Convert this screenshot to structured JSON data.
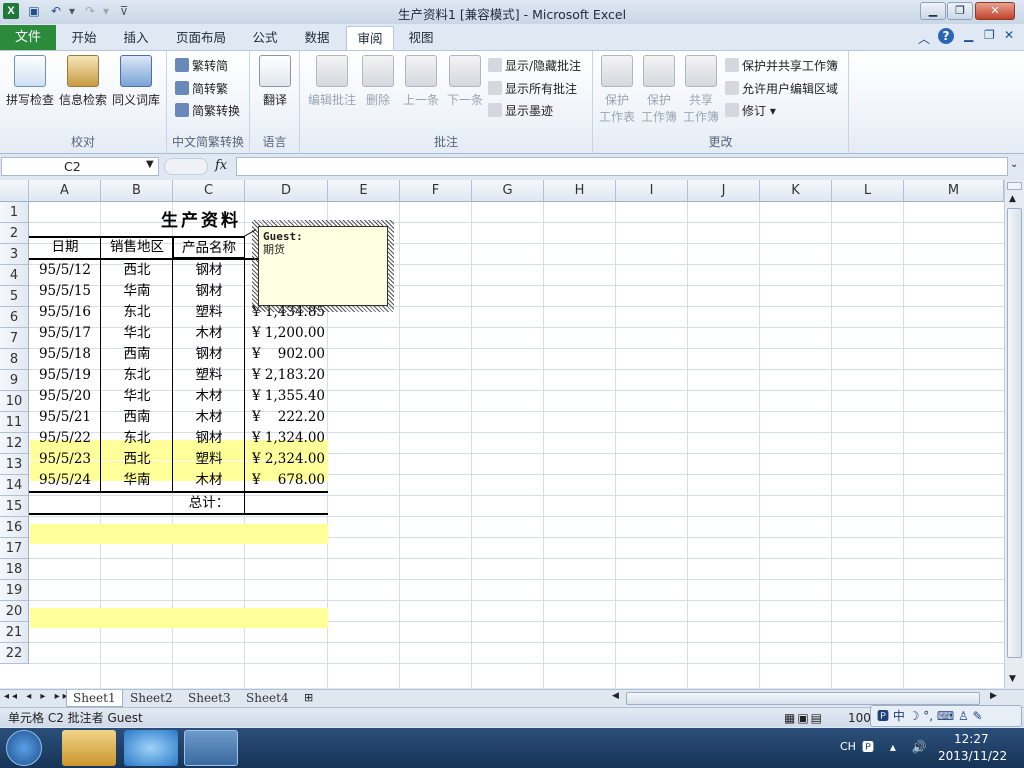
{
  "window": {
    "title": "生产资料1  [兼容模式] - Microsoft Excel",
    "app_icon": "X"
  },
  "tabs": {
    "file": "文件",
    "items": [
      "开始",
      "插入",
      "页面布局",
      "公式",
      "数据",
      "审阅",
      "视图"
    ],
    "active": "审阅"
  },
  "ribbon": {
    "proofing": {
      "label": "校对",
      "spell": "拼写检查",
      "research": "信息检索",
      "thesaurus": "同义词库"
    },
    "chinese": {
      "label": "中文简繁转换",
      "t2s": "繁转简",
      "s2t": "简转繁",
      "convert": "简繁转换"
    },
    "language": {
      "label": "语言",
      "translate": "翻译"
    },
    "comments": {
      "label": "批注",
      "edit": "编辑批注",
      "delete": "删除",
      "prev": "上一条",
      "next": "下一条",
      "show_hide": "显示/隐藏批注",
      "show_all": "显示所有批注",
      "show_ink": "显示墨迹"
    },
    "changes": {
      "label": "更改",
      "protect_sheet_1": "保护",
      "protect_sheet_2": "工作表",
      "protect_book_1": "保护",
      "protect_book_2": "工作簿",
      "share_1": "共享",
      "share_2": "工作簿",
      "protect_share": "保护并共享工作簿",
      "allow_edit": "允许用户编辑区域",
      "track": "修订"
    }
  },
  "formula_bar": {
    "name_box": "C2",
    "fx": "fx",
    "value": ""
  },
  "columns": [
    "A",
    "B",
    "C",
    "D",
    "E",
    "F",
    "G",
    "H",
    "I",
    "J",
    "K",
    "L",
    "M"
  ],
  "rows": [
    "1",
    "2",
    "3",
    "4",
    "5",
    "6",
    "7",
    "8",
    "9",
    "10",
    "11",
    "12",
    "13",
    "14",
    "15",
    "16",
    "17",
    "18",
    "19",
    "20",
    "21",
    "22"
  ],
  "sheet": {
    "title": "生产资料",
    "headers": [
      "日期",
      "销售地区",
      "产品名称"
    ],
    "data": [
      {
        "date": "95/5/12",
        "region": "西北",
        "product": "钢材",
        "amount": ""
      },
      {
        "date": "95/5/15",
        "region": "华南",
        "product": "钢材",
        "amount": ""
      },
      {
        "date": "95/5/16",
        "region": "东北",
        "product": "塑料",
        "amount": "¥ 1,434.85"
      },
      {
        "date": "95/5/17",
        "region": "华北",
        "product": "木材",
        "amount": "¥ 1,200.00"
      },
      {
        "date": "95/5/18",
        "region": "西南",
        "product": "钢材",
        "amount": "¥    902.00"
      },
      {
        "date": "95/5/19",
        "region": "东北",
        "product": "塑料",
        "amount": "¥ 2,183.20"
      },
      {
        "date": "95/5/20",
        "region": "华北",
        "product": "木材",
        "amount": "¥ 1,355.40"
      },
      {
        "date": "95/5/21",
        "region": "西南",
        "product": "木材",
        "amount": "¥    222.20"
      },
      {
        "date": "95/5/22",
        "region": "东北",
        "product": "钢材",
        "amount": "¥ 1,324.00"
      },
      {
        "date": "95/5/23",
        "region": "西北",
        "product": "塑料",
        "amount": "¥ 2,324.00"
      },
      {
        "date": "95/5/24",
        "region": "华南",
        "product": "木材",
        "amount": "¥    678.00"
      }
    ],
    "total_label": "总计："
  },
  "comment": {
    "author": "Guest:",
    "text": "期货"
  },
  "sheet_tabs": [
    "Sheet1",
    "Sheet2",
    "Sheet3",
    "Sheet4"
  ],
  "status": {
    "text": "单元格 C2 批注者 Guest",
    "zoom": "100"
  },
  "taskbar": {
    "lang": "CH",
    "time": "12:27",
    "date": "2013/11/22"
  },
  "colors": {
    "highlight": "#ffff99",
    "file_tab": "#2c8a3c",
    "comment_bg": "#ffffe1"
  }
}
